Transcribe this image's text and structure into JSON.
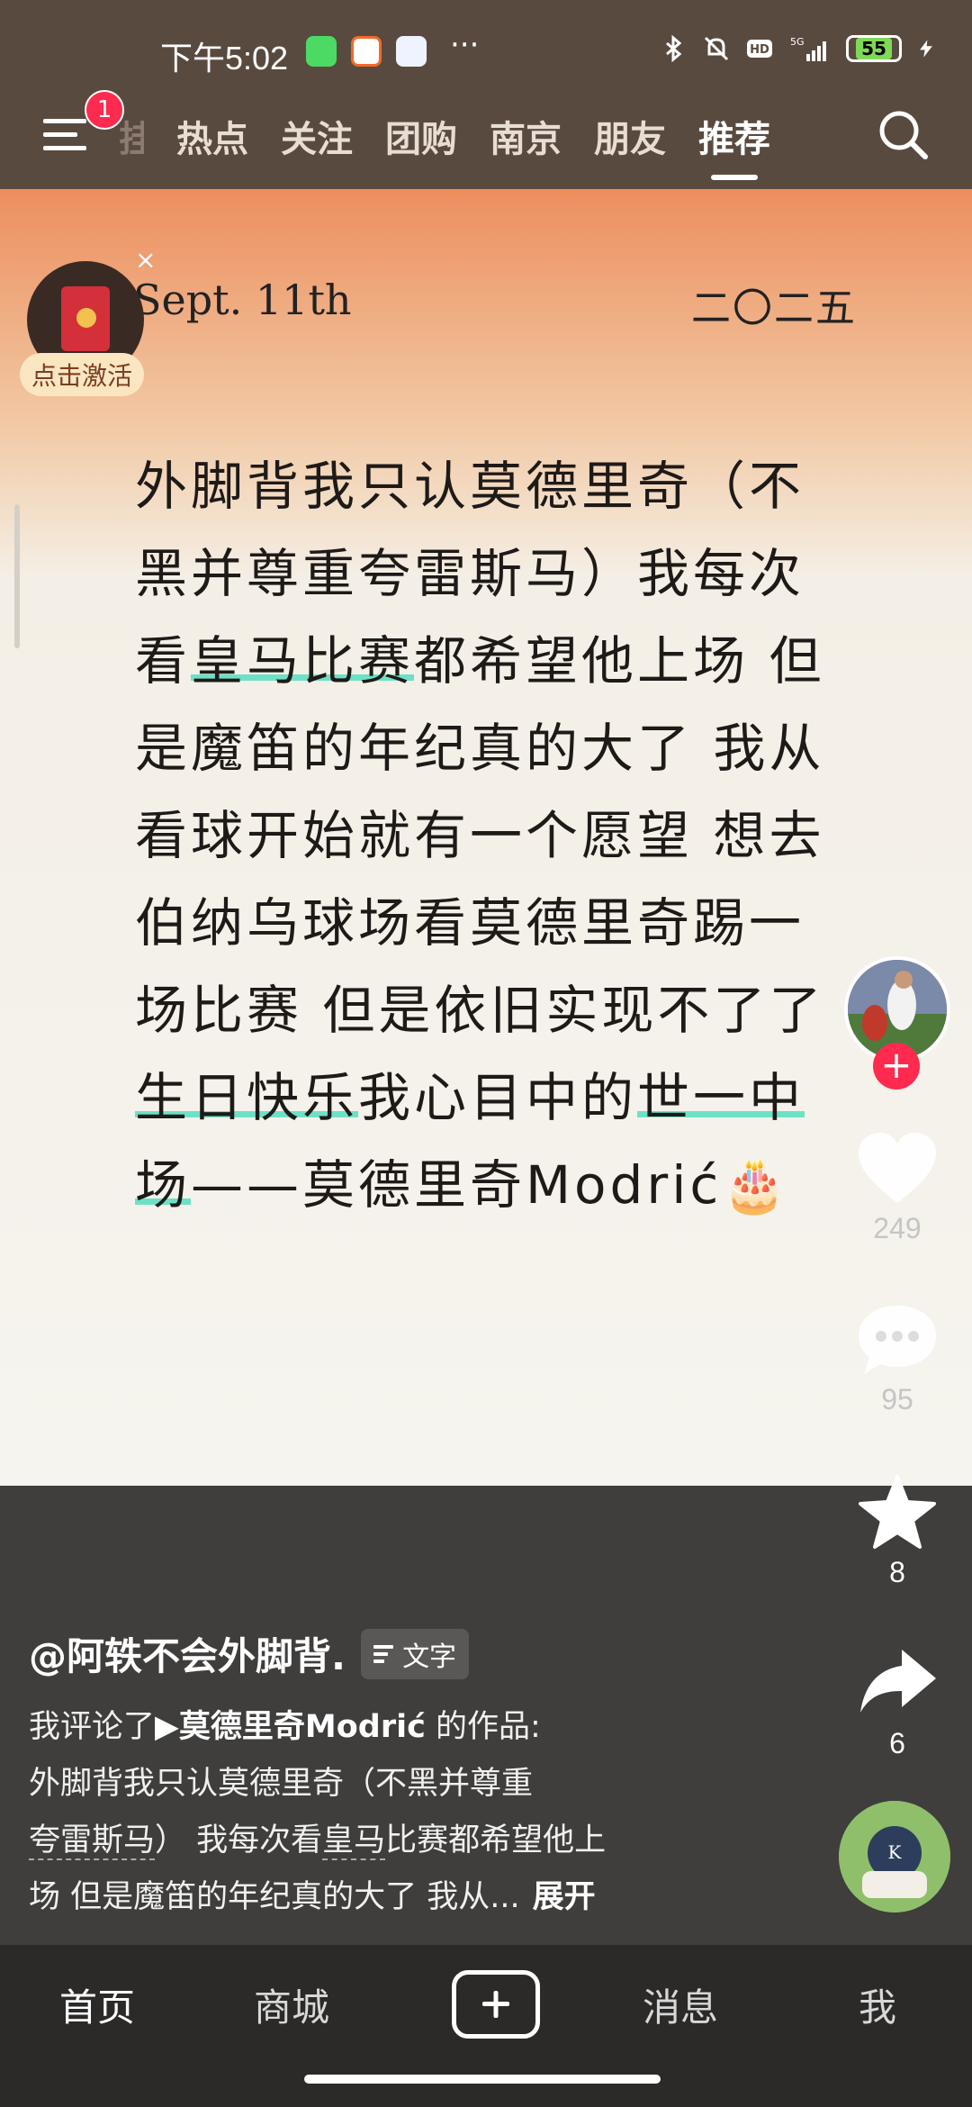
{
  "status_bar": {
    "time": "下午5:02",
    "more": "···",
    "battery": "55"
  },
  "top_nav": {
    "badge": "1",
    "tabs": [
      {
        "label": "热点"
      },
      {
        "label": "关注"
      },
      {
        "label": "团购"
      },
      {
        "label": "南京"
      },
      {
        "label": "朋友"
      },
      {
        "label": "推荐",
        "active": true
      }
    ]
  },
  "note": {
    "date_left": "Sept. 11th",
    "date_right": "二〇二五",
    "seg1": "外脚背我只认莫德里奇（不黑并尊重夸雷斯马）我每次看",
    "hl1": "皇马比赛",
    "seg2": "都希望他上场 但是魔笛的年纪真的大了 我从看球开始就有一个愿望 想去伯纳乌球场看莫德里奇踢一场比赛 但是依旧实现不了了 ",
    "hl2": "生日快乐",
    "seg3": "我心目中的",
    "hl3": "世一中场",
    "seg4": "——莫德里奇Modrić🎂"
  },
  "redpacket": {
    "label": "点击激活",
    "close": "×"
  },
  "actions": {
    "likes": "249",
    "comments": "95",
    "favorites": "8",
    "shares": "6"
  },
  "post": {
    "author": "@阿轶不会外脚背.",
    "tag": "文字",
    "line1_prefix": "我评论了",
    "line1_ref": "▶莫德里奇Modrić",
    "line1_suffix": " 的作品:",
    "line2": "外脚背我只认莫德里奇（不黑并尊重",
    "line3_a": "夸雷斯马",
    "line3_b": "） 我每次看",
    "line3_c": "皇马",
    "line3_d": "比赛都希望他上",
    "line4": "场 但是魔笛的年纪真的大了 我从...",
    "expand": "展开"
  },
  "bottom_nav": {
    "home": "首页",
    "mall": "商城",
    "messages": "消息",
    "me": "我"
  },
  "colors": {
    "accent": "#ff2a4f",
    "highlight": "#6de1c5",
    "header_bg": "#594a40"
  }
}
